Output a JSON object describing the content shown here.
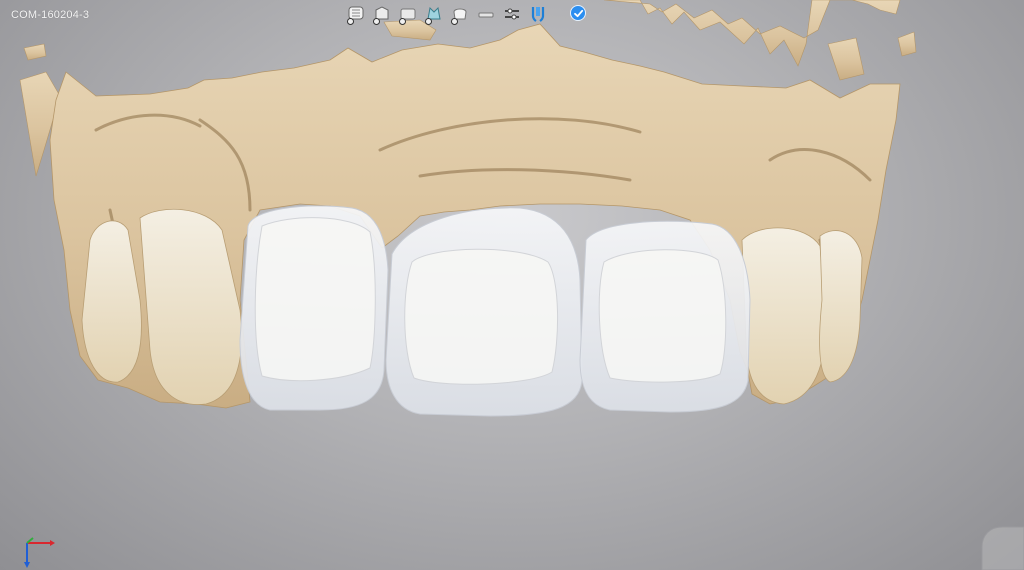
{
  "app": {
    "case_id": "COM-160204-3"
  },
  "toolbar": {
    "tools": [
      {
        "icon": "jaw-model-icon"
      },
      {
        "icon": "prep-model-icon"
      },
      {
        "icon": "crown-shell-icon"
      },
      {
        "icon": "antagonist-icon"
      },
      {
        "icon": "restoration-icon"
      },
      {
        "icon": "pontic-icon"
      },
      {
        "icon": "sliders-icon"
      },
      {
        "icon": "implant-icon"
      }
    ],
    "confirm_icon": "checkmark-icon"
  },
  "viewport": {
    "background_colors": [
      "#c9c9cc",
      "#b1b1b4",
      "#8f8f93"
    ],
    "gingiva_color": "#dcc7a4",
    "restoration_color": "#eef0f3"
  },
  "axis": {
    "x_color": "#d9282f",
    "y_color": "#1f5fd6",
    "z_color": "#2fae3c"
  }
}
